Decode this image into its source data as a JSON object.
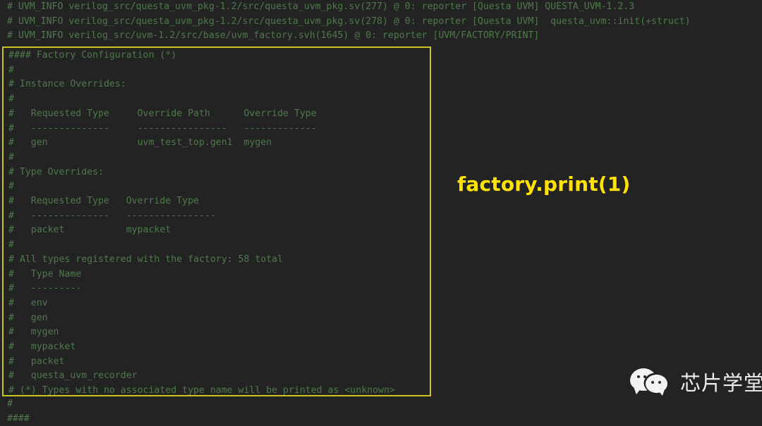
{
  "terminal": {
    "background_color": "#232323",
    "log_text_color": "#4e7a4a",
    "highlight_border_color": "#c9c21f",
    "annotation_color": "#ffe200",
    "top_log_lines": [
      "# UVM_INFO verilog_src/questa_uvm_pkg-1.2/src/questa_uvm_pkg.sv(277) @ 0: reporter [Questa UVM] QUESTA_UVM-1.2.3",
      "# UVM_INFO verilog_src/questa_uvm_pkg-1.2/src/questa_uvm_pkg.sv(278) @ 0: reporter [Questa UVM]  questa_uvm::init(+struct)",
      "# UVM_INFO verilog_src/uvm-1.2/src/base/uvm_factory.svh(1645) @ 0: reporter [UVM/FACTORY/PRINT]"
    ],
    "factory_box_lines": [
      "#### Factory Configuration (*)",
      "#",
      "# Instance Overrides:",
      "#",
      "#   Requested Type     Override Path      Override Type",
      "#   --------------     ----------------   -------------",
      "#   gen                uvm_test_top.gen1  mygen",
      "#",
      "# Type Overrides:",
      "#",
      "#   Requested Type   Override Type",
      "#   --------------   ----------------",
      "#   packet           mypacket",
      "#",
      "# All types registered with the factory: 58 total",
      "#   Type Name",
      "#   ---------",
      "#   env",
      "#   gen",
      "#   mygen",
      "#   mypacket",
      "#   packet",
      "#   questa_uvm_recorder",
      "# (*) Types with no associated type name will be printed as <unknown>"
    ],
    "bottom_log_lines": [
      "#",
      "####"
    ]
  },
  "annotation": {
    "label": "factory.print(1)"
  },
  "watermark": {
    "icon": "wechat-icon",
    "text": "芯片学堂"
  }
}
